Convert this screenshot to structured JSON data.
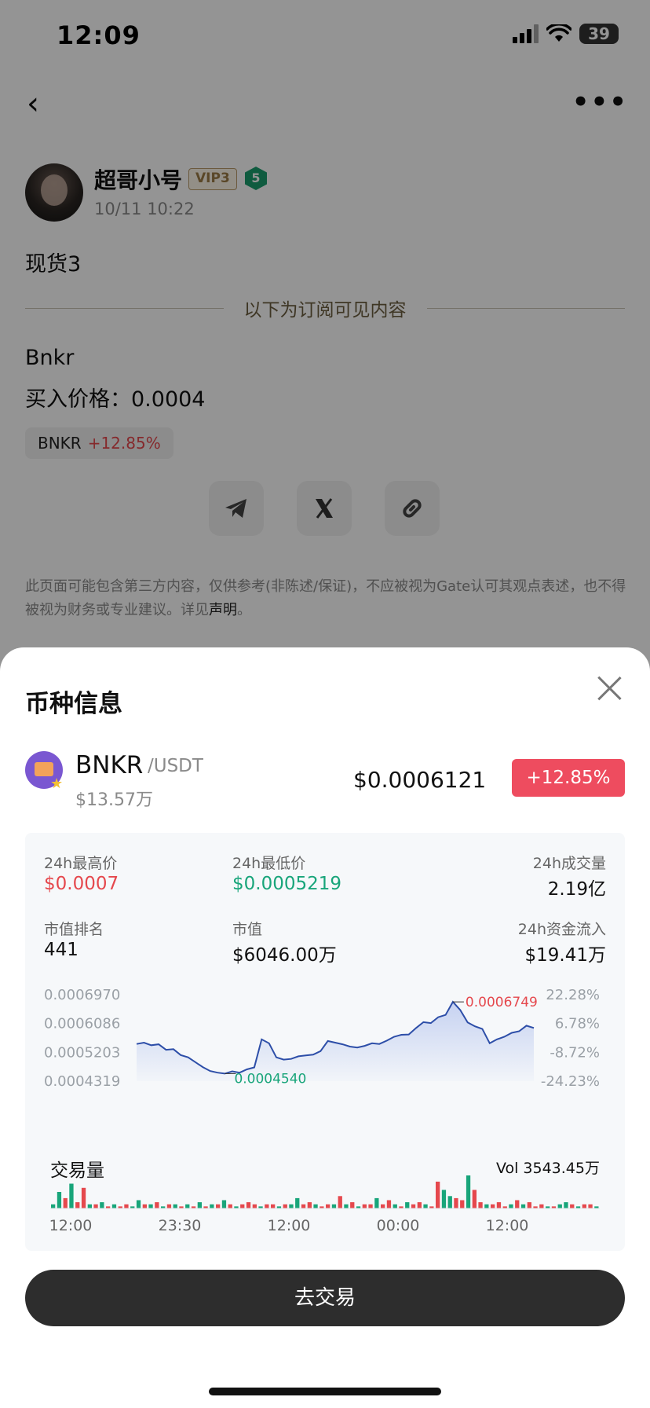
{
  "status_bar": {
    "time": "12:09",
    "battery": "39"
  },
  "post": {
    "author": "超哥小号",
    "vip": "VIP3",
    "level": "5",
    "time": "10/11 10:22",
    "title": "现货3",
    "divider_text": "以下为订阅可见内容",
    "line1": "Bnkr",
    "line2": "买入价格：0.0004",
    "tag_symbol": "BNKR",
    "tag_change": "+12.85%",
    "disclaimer": "此页面可能包含第三方内容，仅供参考(非陈述/保证)，不应被视为Gate认可其观点表述，也不得被视为财务或专业建议。详见",
    "disclaimer_link": "声明",
    "disclaimer_end": "。"
  },
  "sheet": {
    "title": "币种信息",
    "coin": {
      "symbol": "BNKR",
      "quote": "/USDT",
      "market_cap_short": "$13.57万",
      "price": "$0.0006121",
      "change": "+12.85%"
    },
    "stats": {
      "high_label": "24h最高价",
      "high_value": "$0.0007",
      "low_label": "24h最低价",
      "low_value": "$0.0005219",
      "volume_label": "24h成交量",
      "volume_value": "2.19亿",
      "rank_label": "市值排名",
      "rank_value": "441",
      "mcap_label": "市值",
      "mcap_value": "$6046.00万",
      "inflow_label": "24h资金流入",
      "inflow_value": "$19.41万"
    },
    "volume_title": "交易量",
    "volume_total": "Vol 3543.45万",
    "trade_button": "去交易"
  },
  "chart_data": [
    {
      "type": "area",
      "ylim": [
        0.0004319,
        0.000697
      ],
      "y_ticks_left": [
        "0.0006970",
        "0.0006086",
        "0.0005203",
        "0.0004319"
      ],
      "y_ticks_right": [
        "22.28%",
        "6.78%",
        "-8.72%",
        "-24.23%"
      ],
      "high_label": "0.0006749",
      "low_label": "0.0004540",
      "series": [
        {
          "values": [
            0.000546,
            0.00055,
            0.000542,
            0.000545,
            0.000528,
            0.00053,
            0.000512,
            0.000505,
            0.00049,
            0.000475,
            0.000463,
            0.000458,
            0.000455,
            0.000462,
            0.000458,
            0.000468,
            0.000474,
            0.00056,
            0.000548,
            0.000505,
            0.000498,
            0.0005,
            0.000508,
            0.000511,
            0.000513,
            0.000524,
            0.000555,
            0.00055,
            0.000545,
            0.000538,
            0.000535,
            0.00054,
            0.000548,
            0.000546,
            0.000556,
            0.000568,
            0.000574,
            0.000575,
            0.000595,
            0.000613,
            0.00061,
            0.000628,
            0.000635,
            0.000675,
            0.00065,
            0.000612,
            0.0006,
            0.000592,
            0.000548,
            0.00056,
            0.000568,
            0.00058,
            0.000585,
            0.000602,
            0.000595
          ]
        }
      ]
    },
    {
      "type": "bar",
      "x_tick_labels": [
        "12:00",
        "23:30",
        "12:00",
        "00:00",
        "12:00"
      ],
      "series": [
        {
          "values": [
            2,
            8,
            5,
            12,
            3,
            10,
            2,
            2,
            3,
            1,
            2,
            1,
            2,
            1,
            4,
            2,
            2,
            3,
            1,
            2,
            2,
            1,
            2,
            1,
            3,
            1,
            2,
            2,
            4,
            2,
            1,
            2,
            3,
            2,
            1,
            2,
            2,
            1,
            2,
            2,
            5,
            2,
            3,
            2,
            1,
            2,
            2,
            6,
            2,
            3,
            1,
            2,
            2,
            5,
            2,
            4,
            2,
            1,
            3,
            2,
            3,
            2,
            1,
            13,
            9,
            6,
            5,
            4,
            16,
            9,
            3,
            2,
            2,
            3,
            1,
            2,
            4,
            2,
            3,
            1,
            2,
            1,
            1,
            2,
            3,
            2,
            1,
            2,
            2,
            1
          ],
          "directions": [
            "g",
            "g",
            "r",
            "g",
            "r",
            "r",
            "g",
            "r",
            "g",
            "r",
            "g",
            "r",
            "r",
            "g",
            "g",
            "r",
            "g",
            "r",
            "g",
            "r",
            "g",
            "r",
            "g",
            "r",
            "g",
            "r",
            "g",
            "r",
            "g",
            "r",
            "g",
            "r",
            "r",
            "r",
            "g",
            "r",
            "r",
            "g",
            "r",
            "g",
            "g",
            "r",
            "r",
            "g",
            "r",
            "r",
            "g",
            "r",
            "g",
            "r",
            "g",
            "r",
            "r",
            "g",
            "r",
            "r",
            "g",
            "r",
            "g",
            "r",
            "r",
            "g",
            "r",
            "r",
            "g",
            "g",
            "r",
            "r",
            "g",
            "r",
            "r",
            "g",
            "r",
            "r",
            "r",
            "g",
            "r",
            "g",
            "r",
            "r",
            "r",
            "g",
            "r",
            "g",
            "g",
            "r",
            "g",
            "r",
            "r",
            "g"
          ]
        }
      ]
    }
  ],
  "colors": {
    "up": "#e5484d",
    "down": "#18a57a",
    "line": "#2d4ea8",
    "pill": "#ee4c5f"
  }
}
